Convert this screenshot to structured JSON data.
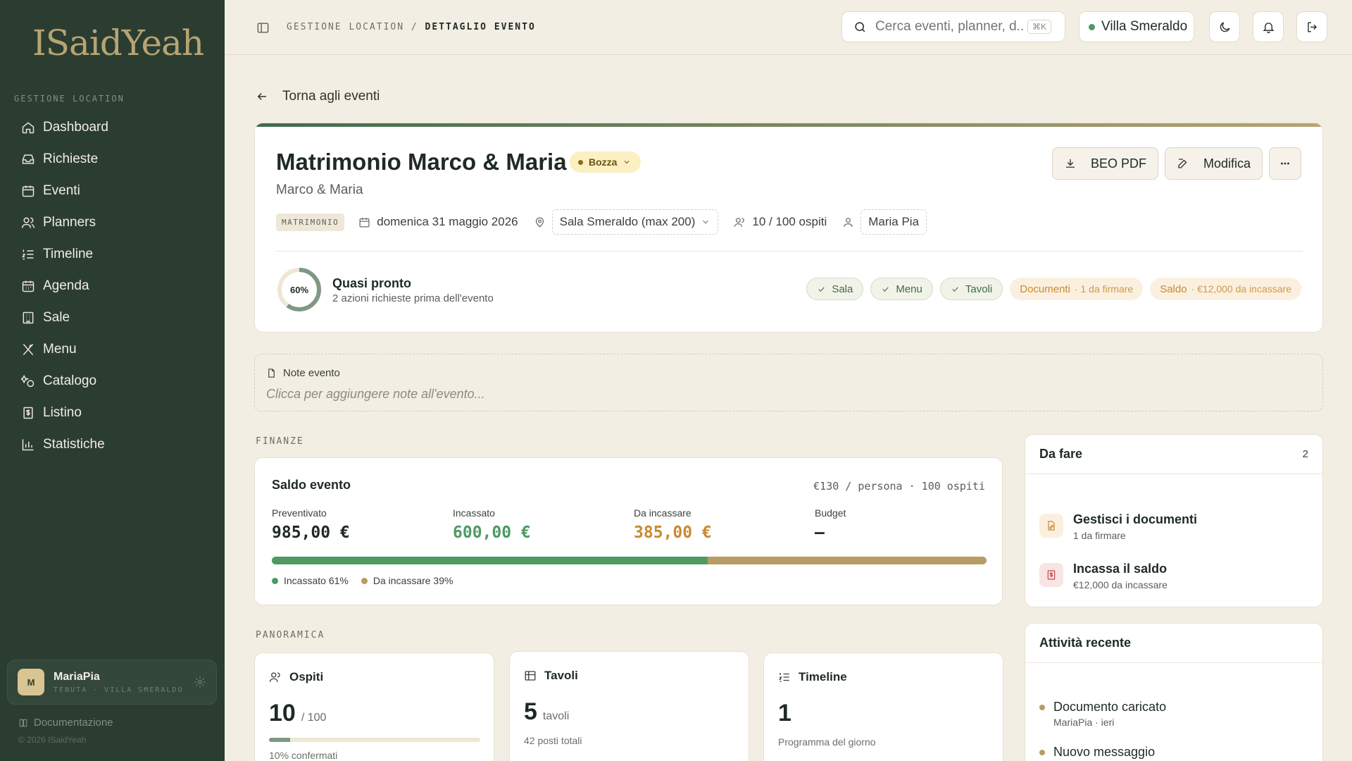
{
  "brand": {
    "logo_text": "ISaidYeah"
  },
  "sidebar": {
    "section": "GESTIONE LOCATION",
    "items": [
      {
        "label": "Dashboard",
        "icon": "home-icon"
      },
      {
        "label": "Richieste",
        "icon": "inbox-icon"
      },
      {
        "label": "Eventi",
        "icon": "calendar-icon"
      },
      {
        "label": "Planners",
        "icon": "users-icon"
      },
      {
        "label": "Timeline",
        "icon": "list-ordered-icon"
      },
      {
        "label": "Agenda",
        "icon": "calendar-days-icon"
      },
      {
        "label": "Sale",
        "icon": "building-icon"
      },
      {
        "label": "Menu",
        "icon": "utensils-icon"
      },
      {
        "label": "Catalogo",
        "icon": "shapes-icon"
      },
      {
        "label": "Listino",
        "icon": "receipt-icon"
      },
      {
        "label": "Statistiche",
        "icon": "bar-chart-icon"
      }
    ],
    "user": {
      "initial": "M",
      "name": "MariaPia",
      "sub": "TENUTA · VILLA SMERALDO"
    },
    "docs_label": "Documentazione",
    "copyright": "© 2026 ISaidYeah"
  },
  "topbar": {
    "breadcrumb_root": "GESTIONE LOCATION",
    "breadcrumb_sep": "/",
    "breadcrumb_current": "DETTAGLIO EVENTO",
    "search_placeholder": "Cerca eventi, planner, d...",
    "search_shortcut": "⌘K",
    "venue": "Villa Smeraldo",
    "venue_status_color": "#4d9a63"
  },
  "back_label": "Torna agli eventi",
  "event": {
    "title": "Matrimonio Marco & Maria",
    "status": "Bozza",
    "couple": "Marco & Maria",
    "type": "MATRIMONIO",
    "date": "domenica 31 maggio 2026",
    "room": "Sala Smeraldo (max 200)",
    "guests": "10 / 100 ospiti",
    "planner": "Maria Pia",
    "actions": {
      "pdf": "BEO PDF",
      "edit": "Modifica"
    },
    "readiness": {
      "percent_label": "60%",
      "percent": 60,
      "title": "Quasi pronto",
      "subtitle": "2 azioni richieste prima dell'evento"
    },
    "checks": [
      {
        "label": "Sala",
        "state": "ok"
      },
      {
        "label": "Menu",
        "state": "ok"
      },
      {
        "label": "Tavoli",
        "state": "ok"
      },
      {
        "label": "Documenti",
        "extra": "· 1 da firmare",
        "state": "warn"
      },
      {
        "label": "Saldo",
        "extra": "· €12,000 da incassare",
        "state": "warn"
      }
    ]
  },
  "notes": {
    "label": "Note evento",
    "placeholder": "Clicca per aggiungere note all'evento..."
  },
  "finance": {
    "section": "FINANZE",
    "title": "Saldo evento",
    "per_person": "€130 / persona · 100 ospiti",
    "cols": [
      {
        "label": "Preventivato",
        "value": "985,00 €",
        "color": "#1f2a24"
      },
      {
        "label": "Incassato",
        "value": "600,00 €",
        "color": "#4d9a63"
      },
      {
        "label": "Da incassare",
        "value": "385,00 €",
        "color": "#c98a2f"
      },
      {
        "label": "Budget",
        "value": "–",
        "color": "#1f2a24"
      }
    ],
    "collected_pct": 61,
    "legend_collected": "Incassato 61%",
    "legend_due": "Da incassare 39%"
  },
  "todo": {
    "title": "Da fare",
    "count": "2",
    "items": [
      {
        "title": "Gestisci i documenti",
        "sub": "1 da firmare"
      },
      {
        "title": "Incassa il saldo",
        "sub": "€12,000 da incassare"
      }
    ]
  },
  "activity": {
    "title": "Attività recente",
    "items": [
      {
        "title": "Documento caricato",
        "sub": "MariaPia · ieri"
      },
      {
        "title": "Nuovo messaggio",
        "sub": ""
      }
    ]
  },
  "overview": {
    "section": "PANORAMICA",
    "guests": {
      "title": "Ospiti",
      "value": "10",
      "total": "/ 100",
      "sub": "10% confermati",
      "pct": 10
    },
    "tables": {
      "title": "Tavoli",
      "value": "5",
      "unit": "tavoli",
      "sub": "42 posti totali"
    },
    "timeline": {
      "title": "Timeline",
      "value": "1",
      "sub": "Programma del giorno"
    }
  }
}
